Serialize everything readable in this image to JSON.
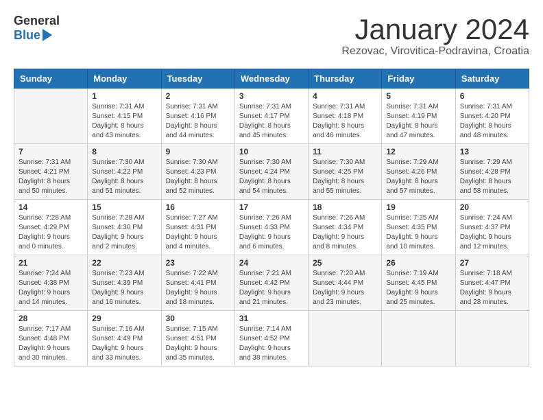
{
  "header": {
    "logo_line1": "General",
    "logo_line2": "Blue",
    "month": "January 2024",
    "location": "Rezovac, Virovitica-Podravina, Croatia"
  },
  "weekdays": [
    "Sunday",
    "Monday",
    "Tuesday",
    "Wednesday",
    "Thursday",
    "Friday",
    "Saturday"
  ],
  "weeks": [
    [
      {
        "day": "",
        "content": ""
      },
      {
        "day": "1",
        "content": "Sunrise: 7:31 AM\nSunset: 4:15 PM\nDaylight: 8 hours\nand 43 minutes."
      },
      {
        "day": "2",
        "content": "Sunrise: 7:31 AM\nSunset: 4:16 PM\nDaylight: 8 hours\nand 44 minutes."
      },
      {
        "day": "3",
        "content": "Sunrise: 7:31 AM\nSunset: 4:17 PM\nDaylight: 8 hours\nand 45 minutes."
      },
      {
        "day": "4",
        "content": "Sunrise: 7:31 AM\nSunset: 4:18 PM\nDaylight: 8 hours\nand 46 minutes."
      },
      {
        "day": "5",
        "content": "Sunrise: 7:31 AM\nSunset: 4:19 PM\nDaylight: 8 hours\nand 47 minutes."
      },
      {
        "day": "6",
        "content": "Sunrise: 7:31 AM\nSunset: 4:20 PM\nDaylight: 8 hours\nand 48 minutes."
      }
    ],
    [
      {
        "day": "7",
        "content": "Sunrise: 7:31 AM\nSunset: 4:21 PM\nDaylight: 8 hours\nand 50 minutes."
      },
      {
        "day": "8",
        "content": "Sunrise: 7:30 AM\nSunset: 4:22 PM\nDaylight: 8 hours\nand 51 minutes."
      },
      {
        "day": "9",
        "content": "Sunrise: 7:30 AM\nSunset: 4:23 PM\nDaylight: 8 hours\nand 52 minutes."
      },
      {
        "day": "10",
        "content": "Sunrise: 7:30 AM\nSunset: 4:24 PM\nDaylight: 8 hours\nand 54 minutes."
      },
      {
        "day": "11",
        "content": "Sunrise: 7:30 AM\nSunset: 4:25 PM\nDaylight: 8 hours\nand 55 minutes."
      },
      {
        "day": "12",
        "content": "Sunrise: 7:29 AM\nSunset: 4:26 PM\nDaylight: 8 hours\nand 57 minutes."
      },
      {
        "day": "13",
        "content": "Sunrise: 7:29 AM\nSunset: 4:28 PM\nDaylight: 8 hours\nand 58 minutes."
      }
    ],
    [
      {
        "day": "14",
        "content": "Sunrise: 7:28 AM\nSunset: 4:29 PM\nDaylight: 9 hours\nand 0 minutes."
      },
      {
        "day": "15",
        "content": "Sunrise: 7:28 AM\nSunset: 4:30 PM\nDaylight: 9 hours\nand 2 minutes."
      },
      {
        "day": "16",
        "content": "Sunrise: 7:27 AM\nSunset: 4:31 PM\nDaylight: 9 hours\nand 4 minutes."
      },
      {
        "day": "17",
        "content": "Sunrise: 7:26 AM\nSunset: 4:33 PM\nDaylight: 9 hours\nand 6 minutes."
      },
      {
        "day": "18",
        "content": "Sunrise: 7:26 AM\nSunset: 4:34 PM\nDaylight: 9 hours\nand 8 minutes."
      },
      {
        "day": "19",
        "content": "Sunrise: 7:25 AM\nSunset: 4:35 PM\nDaylight: 9 hours\nand 10 minutes."
      },
      {
        "day": "20",
        "content": "Sunrise: 7:24 AM\nSunset: 4:37 PM\nDaylight: 9 hours\nand 12 minutes."
      }
    ],
    [
      {
        "day": "21",
        "content": "Sunrise: 7:24 AM\nSunset: 4:38 PM\nDaylight: 9 hours\nand 14 minutes."
      },
      {
        "day": "22",
        "content": "Sunrise: 7:23 AM\nSunset: 4:39 PM\nDaylight: 9 hours\nand 16 minutes."
      },
      {
        "day": "23",
        "content": "Sunrise: 7:22 AM\nSunset: 4:41 PM\nDaylight: 9 hours\nand 18 minutes."
      },
      {
        "day": "24",
        "content": "Sunrise: 7:21 AM\nSunset: 4:42 PM\nDaylight: 9 hours\nand 21 minutes."
      },
      {
        "day": "25",
        "content": "Sunrise: 7:20 AM\nSunset: 4:44 PM\nDaylight: 9 hours\nand 23 minutes."
      },
      {
        "day": "26",
        "content": "Sunrise: 7:19 AM\nSunset: 4:45 PM\nDaylight: 9 hours\nand 25 minutes."
      },
      {
        "day": "27",
        "content": "Sunrise: 7:18 AM\nSunset: 4:47 PM\nDaylight: 9 hours\nand 28 minutes."
      }
    ],
    [
      {
        "day": "28",
        "content": "Sunrise: 7:17 AM\nSunset: 4:48 PM\nDaylight: 9 hours\nand 30 minutes."
      },
      {
        "day": "29",
        "content": "Sunrise: 7:16 AM\nSunset: 4:49 PM\nDaylight: 9 hours\nand 33 minutes."
      },
      {
        "day": "30",
        "content": "Sunrise: 7:15 AM\nSunset: 4:51 PM\nDaylight: 9 hours\nand 35 minutes."
      },
      {
        "day": "31",
        "content": "Sunrise: 7:14 AM\nSunset: 4:52 PM\nDaylight: 9 hours\nand 38 minutes."
      },
      {
        "day": "",
        "content": ""
      },
      {
        "day": "",
        "content": ""
      },
      {
        "day": "",
        "content": ""
      }
    ]
  ]
}
